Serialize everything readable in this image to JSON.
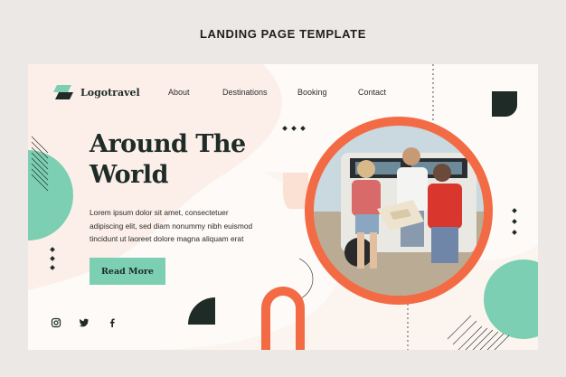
{
  "caption": "LANDING PAGE TEMPLATE",
  "brand": {
    "name": "Logotravel",
    "logo_icon": "leaf-logo-icon",
    "logo_color": "#7ccfb2",
    "logo_dark": "#1e2b27"
  },
  "nav": {
    "items": [
      "About",
      "Destinations",
      "Booking",
      "Contact"
    ]
  },
  "hero": {
    "title_line1": "Around The",
    "title_line2": "World",
    "body_line1": "Lorem ipsum dolor sit amet, consectetuer",
    "body_line2": "adipiscing elit, sed diam nonummy nibh euismod",
    "body_line3": "tincidunt ut laoreet dolore magna aliquam erat",
    "cta_label": "Read More"
  },
  "social": [
    "instagram-icon",
    "twitter-icon",
    "facebook-icon"
  ],
  "colors": {
    "accent_mint": "#7ccfb2",
    "accent_orange": "#f26b45",
    "dark": "#1e2b27",
    "background": "#fdfaf7",
    "page": "#ece8e5"
  }
}
